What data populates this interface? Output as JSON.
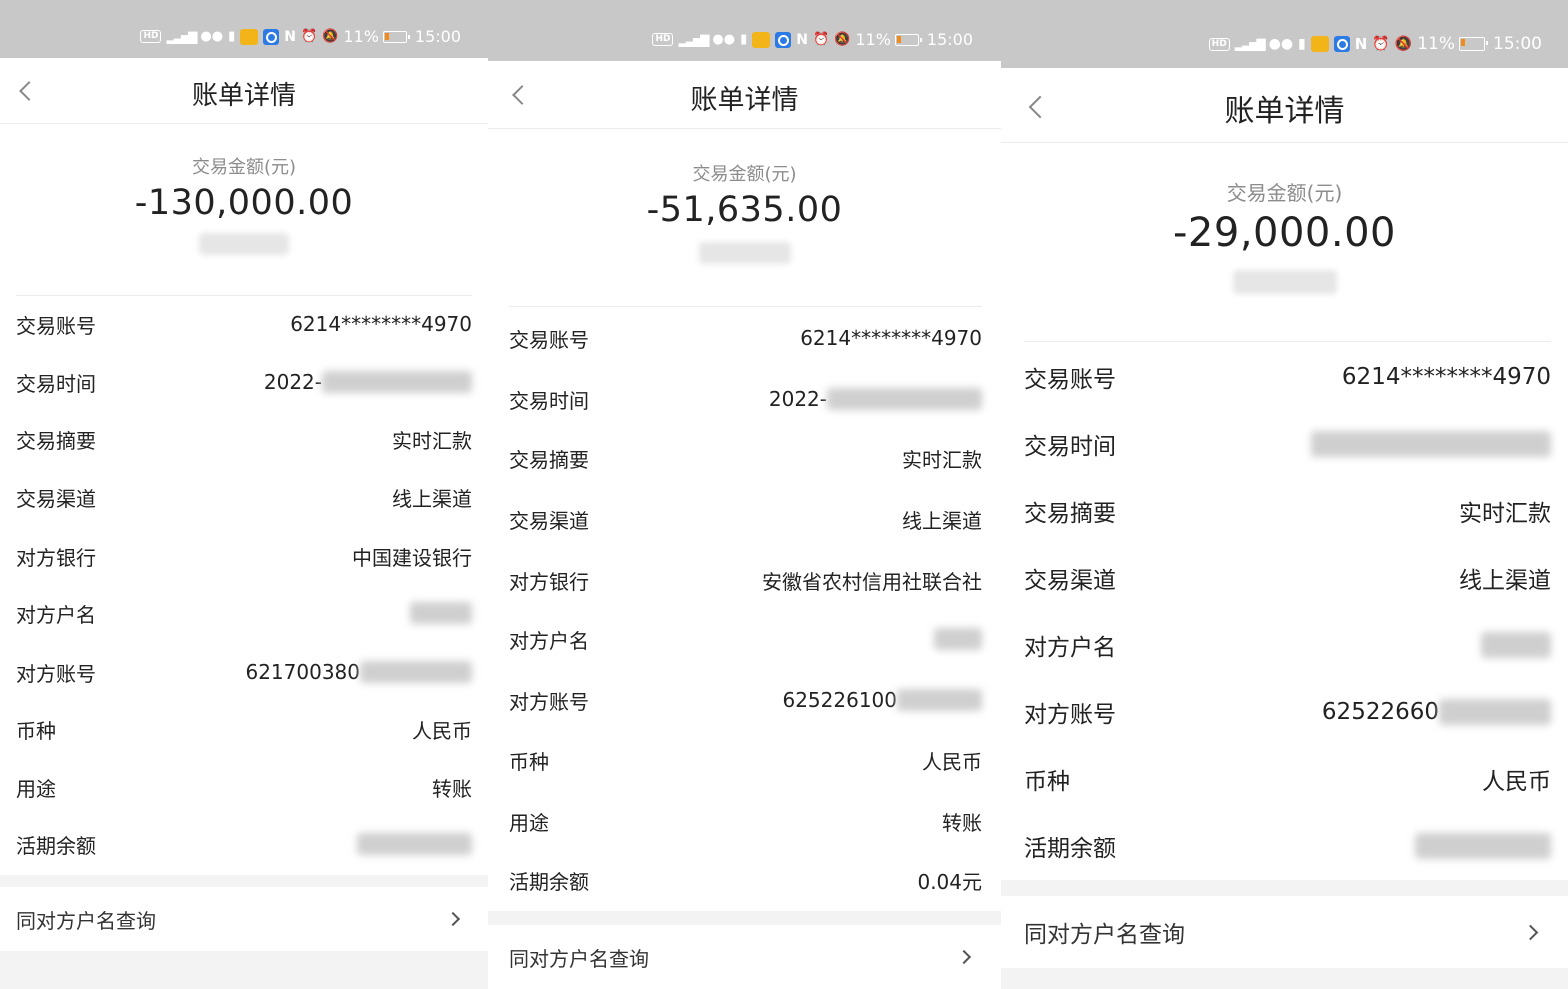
{
  "status_bar": {
    "battery": "11%",
    "time": "15:00",
    "hd": "HD"
  },
  "screens": [
    {
      "title": "账单详情",
      "amount_label": "交易金额(元)",
      "amount": "-130,000.00",
      "rows": [
        {
          "label": "交易账号",
          "value": "6214********4970"
        },
        {
          "label": "交易时间",
          "value": "2022-"
        },
        {
          "label": "交易摘要",
          "value": "实时汇款"
        },
        {
          "label": "交易渠道",
          "value": "线上渠道"
        },
        {
          "label": "对方银行",
          "value": "中国建设银行"
        },
        {
          "label": "对方户名",
          "value": ""
        },
        {
          "label": "对方账号",
          "value": "621700380"
        },
        {
          "label": "币种",
          "value": "人民币"
        },
        {
          "label": "用途",
          "value": "转账"
        },
        {
          "label": "活期余额",
          "value": ""
        }
      ],
      "link_label": "同对方户名查询"
    },
    {
      "title": "账单详情",
      "amount_label": "交易金额(元)",
      "amount": "-51,635.00",
      "rows": [
        {
          "label": "交易账号",
          "value": "6214********4970"
        },
        {
          "label": "交易时间",
          "value": "2022-"
        },
        {
          "label": "交易摘要",
          "value": "实时汇款"
        },
        {
          "label": "交易渠道",
          "value": "线上渠道"
        },
        {
          "label": "对方银行",
          "value": "安徽省农村信用社联合社"
        },
        {
          "label": "对方户名",
          "value": ""
        },
        {
          "label": "对方账号",
          "value": "625226100"
        },
        {
          "label": "币种",
          "value": "人民币"
        },
        {
          "label": "用途",
          "value": "转账"
        },
        {
          "label": "活期余额",
          "value": "0.04元"
        }
      ],
      "link_label": "同对方户名查询"
    },
    {
      "title": "账单详情",
      "amount_label": "交易金额(元)",
      "amount": "-29,000.00",
      "rows": [
        {
          "label": "交易账号",
          "value": "6214********4970"
        },
        {
          "label": "交易时间",
          "value": ""
        },
        {
          "label": "交易摘要",
          "value": "实时汇款"
        },
        {
          "label": "交易渠道",
          "value": "线上渠道"
        },
        {
          "label": "对方户名",
          "value": ""
        },
        {
          "label": "对方账号",
          "value": "62522660"
        },
        {
          "label": "币种",
          "value": "人民币"
        },
        {
          "label": "活期余额",
          "value": ""
        }
      ],
      "link_label": "同对方户名查询"
    }
  ]
}
